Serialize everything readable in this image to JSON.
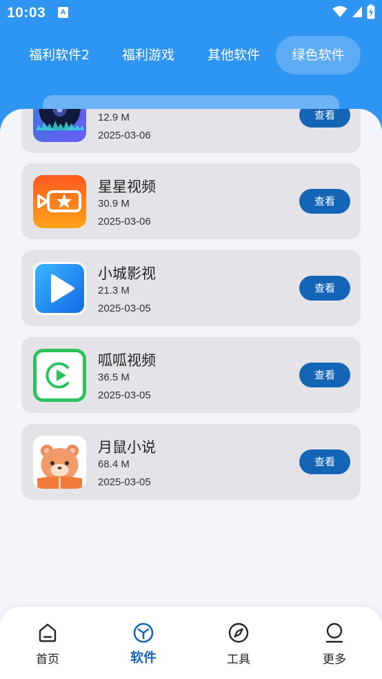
{
  "status_bar": {
    "time": "10:03",
    "notification_glyph": "A",
    "icons": [
      "wifi-icon",
      "signal-icon",
      "battery-charging-icon"
    ]
  },
  "tabs": [
    {
      "label": "福利软件2",
      "active": false
    },
    {
      "label": "福利游戏",
      "active": false
    },
    {
      "label": "其他软件",
      "active": false
    },
    {
      "label": "绿色软件",
      "active": true
    }
  ],
  "apps": [
    {
      "name": "",
      "size": "12.9 M",
      "date": "2025-03-06",
      "button": "查看",
      "icon": "music-disc-app-icon"
    },
    {
      "name": "星星视频",
      "size": "30.9 M",
      "date": "2025-03-06",
      "button": "查看",
      "icon": "star-video-app-icon"
    },
    {
      "name": "小城影视",
      "size": "21.3 M",
      "date": "2025-03-05",
      "button": "查看",
      "icon": "play-triangle-app-icon"
    },
    {
      "name": "呱呱视频",
      "size": "36.5 M",
      "date": "2025-03-05",
      "button": "查看",
      "icon": "green-play-app-icon"
    },
    {
      "name": "月鼠小说",
      "size": "68.4 M",
      "date": "2025-03-05",
      "button": "查看",
      "icon": "hamster-book-app-icon"
    }
  ],
  "bottom_nav": [
    {
      "label": "首页",
      "icon": "home-icon",
      "active": false
    },
    {
      "label": "软件",
      "icon": "cube-icon",
      "active": true
    },
    {
      "label": "工具",
      "icon": "compass-icon",
      "active": false
    },
    {
      "label": "更多",
      "icon": "user-icon",
      "active": false
    }
  ],
  "colors": {
    "header": "#2e95f2",
    "accent": "#1565b6",
    "card": "#e3e3e8",
    "background": "#f4f5f9"
  }
}
